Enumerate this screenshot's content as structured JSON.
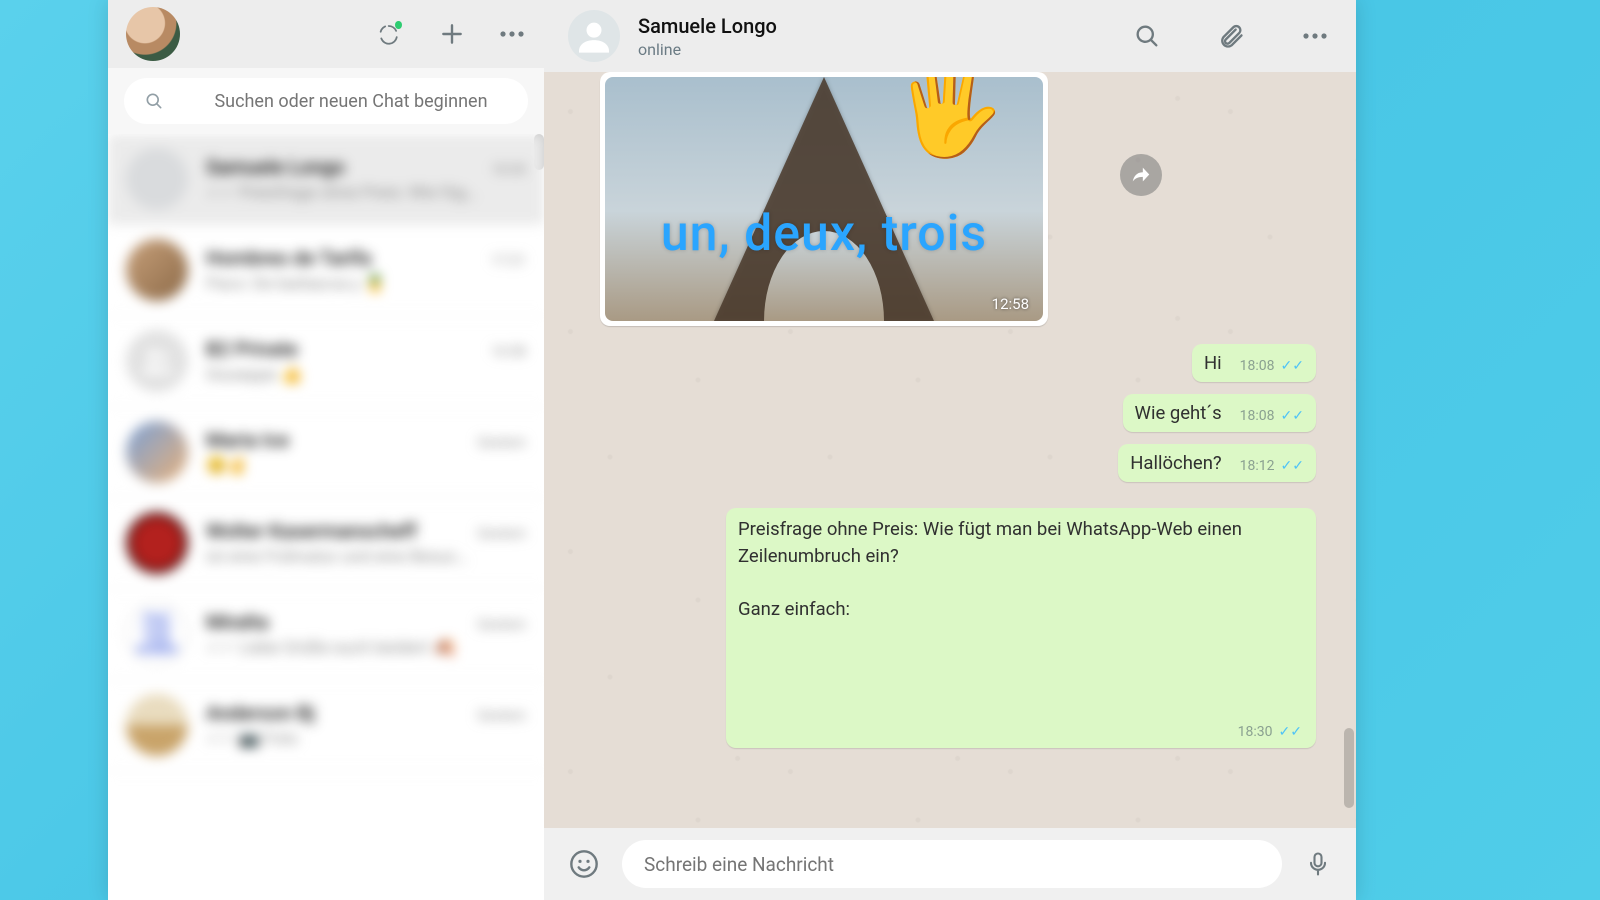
{
  "search": {
    "placeholder": "Suchen oder neuen Chat beginnen"
  },
  "sidebar": {
    "items": [
      {
        "name": "Samuele Longo",
        "time": "18:30",
        "preview": "✓✓ Preisfrage ohne Preis: Wie füg…"
      },
      {
        "name": "Hombres de Tarifa",
        "time": "17:21",
        "preview": "Paco: De barbacoa y 🍍"
      },
      {
        "name": "B2 Private",
        "time": "16:58",
        "preview": "Giuseppe 👍"
      },
      {
        "name": "Maria Ice",
        "time": "Gestern",
        "preview": "😊✌️"
      },
      {
        "name": "Wolter Kasermanscheff",
        "time": "Gestern",
        "preview": "ist eine Frühnatur und eine Besuc…"
      },
      {
        "name": "Miralta",
        "time": "Gestern",
        "preview": "✓✓ Liebe Grüße euch beiden! 🍂"
      },
      {
        "name": "Anderson Bj",
        "time": "Gestern",
        "preview": "✓✓ 📷 Foto"
      }
    ]
  },
  "conversation": {
    "name": "Samuele Longo",
    "status": "online",
    "image_msg": {
      "caption": "un, deux, trois",
      "time": "12:58"
    },
    "msgs": [
      {
        "text": "Hi",
        "time": "18:08"
      },
      {
        "text": "Wie geht´s",
        "time": "18:08"
      },
      {
        "text": "Hallöchen?",
        "time": "18:12"
      }
    ],
    "big_msg": {
      "text": "Preisfrage ohne Preis: Wie fügt man bei WhatsApp-Web einen Zeilenumbruch ein?\n\nGanz einfach:",
      "time": "18:30"
    }
  },
  "composer": {
    "placeholder": "Schreib eine Nachricht"
  }
}
